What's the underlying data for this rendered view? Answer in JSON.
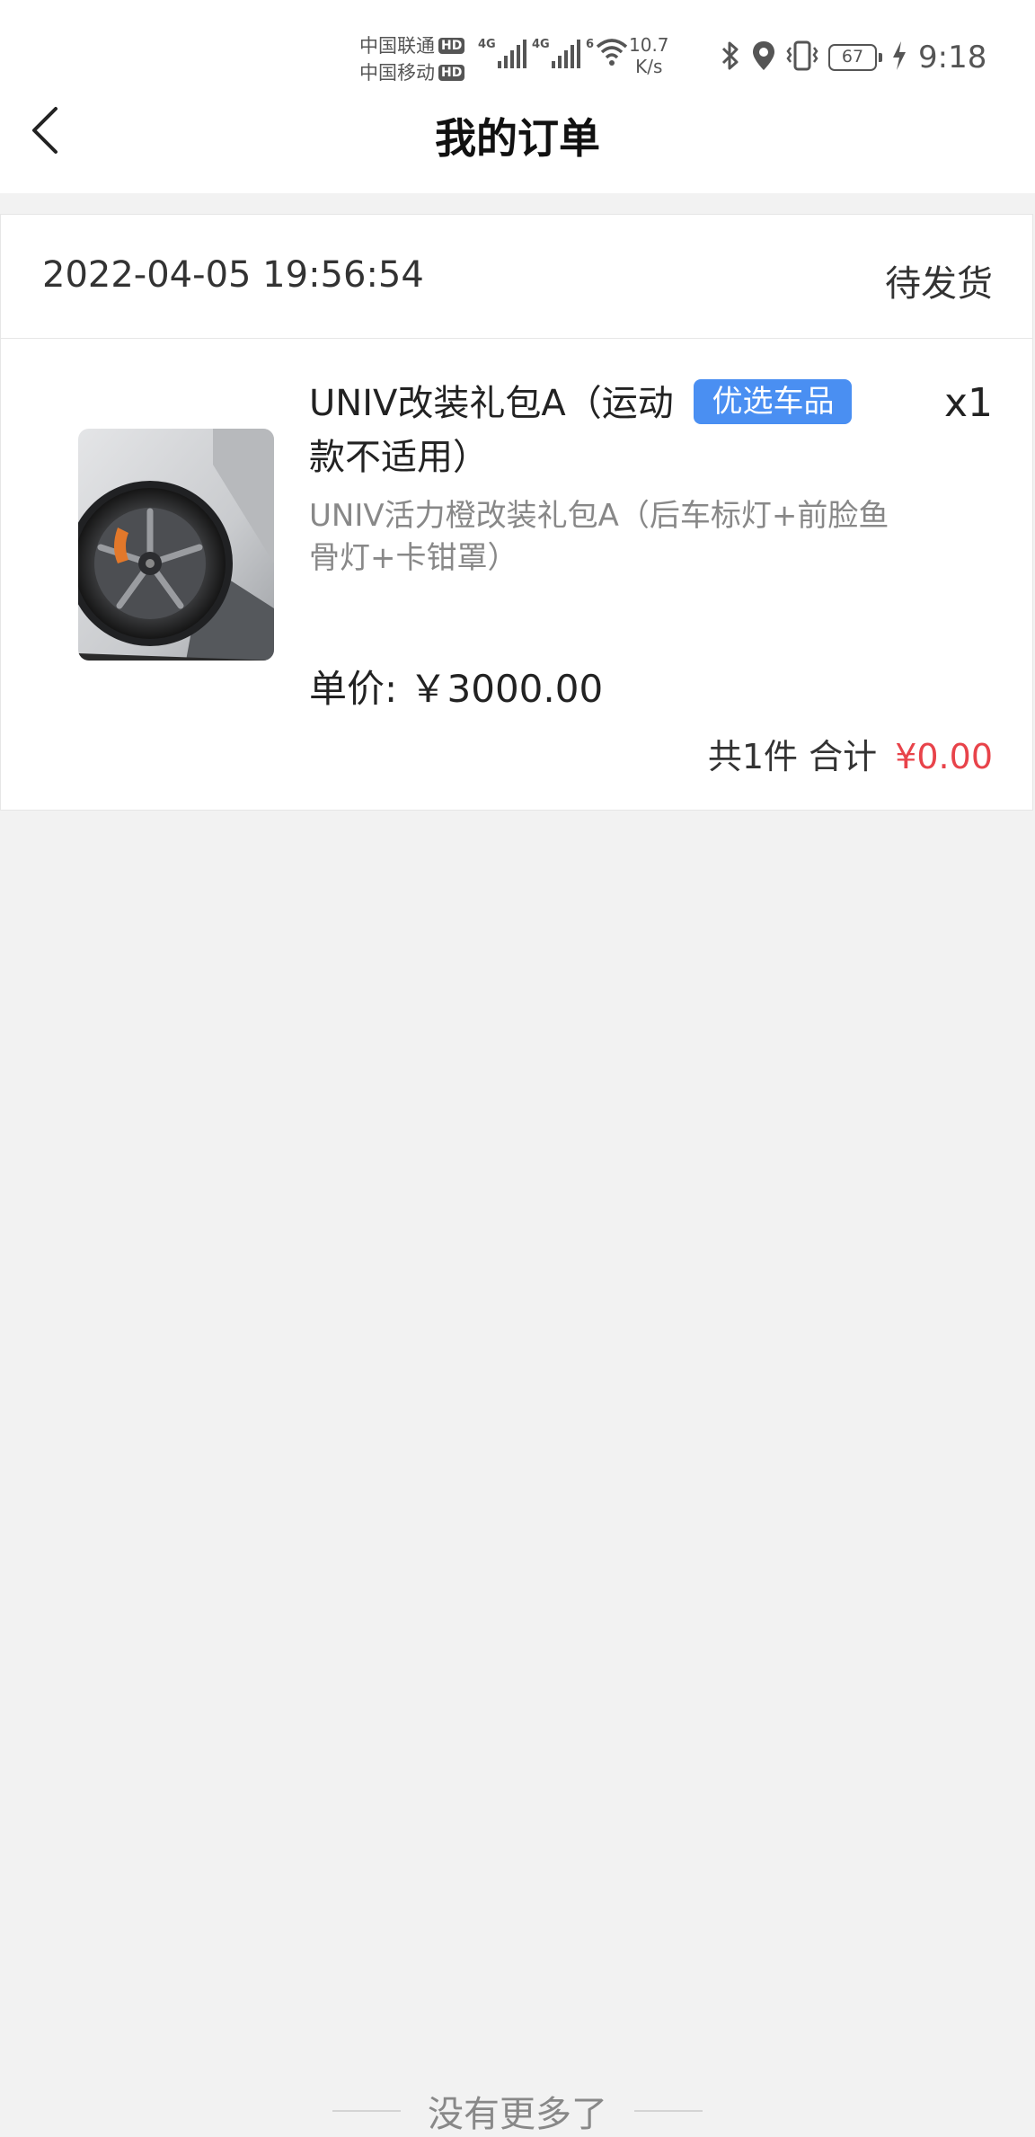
{
  "status_bar": {
    "carrier_1": "中国联通",
    "carrier_2": "中国移动",
    "hd_label": "HD",
    "net_type_1": "4G",
    "net_type_2": "4G",
    "wifi_label": "6",
    "net_speed_value": "10.7",
    "net_speed_unit": "K/s",
    "battery_level": "67",
    "time": "9:18",
    "icons": [
      "bluetooth-icon",
      "location-icon",
      "vibrate-icon",
      "battery-icon",
      "charging-icon"
    ]
  },
  "header": {
    "title": "我的订单",
    "back_icon": "chevron-left-icon"
  },
  "order": {
    "time": "2022-04-05 19:56:54",
    "status": "待发货",
    "product": {
      "name": "UNIV改装礼包A（运动款不适用）",
      "name_part_1": "UNIV改装礼包A（运动",
      "name_part_2": "款不适用）",
      "tag": "优选车品",
      "quantity": "x1",
      "description": "UNIV活力橙改装礼包A（后车标灯+前脸鱼骨灯+卡钳罩）",
      "unit_price": "单价: ￥3000.00"
    },
    "summary_count": "共1件 合计",
    "summary_amount": "¥0.00"
  },
  "footer": {
    "no_more_text": "没有更多了"
  },
  "colors": {
    "tag_bg": "#4a8ff2",
    "price_red": "#e8434a",
    "page_bg": "#f2f2f2"
  }
}
